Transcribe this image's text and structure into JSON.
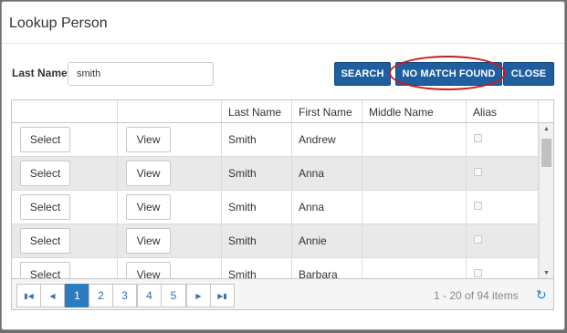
{
  "dialog": {
    "title": "Lookup Person"
  },
  "search": {
    "last_name_label": "Last Name",
    "last_name_value": "smith",
    "search_label": "SEARCH",
    "no_match_label": "NO MATCH FOUND",
    "close_label": "CLOSE"
  },
  "grid": {
    "columns": [
      "",
      "",
      "Last Name",
      "First Name",
      "Middle Name",
      "Alias"
    ],
    "select_label": "Select",
    "view_label": "View",
    "rows": [
      {
        "last": "Smith",
        "first": "Andrew",
        "middle": "",
        "alias": false
      },
      {
        "last": "Smith",
        "first": "Anna",
        "middle": "",
        "alias": false
      },
      {
        "last": "Smith",
        "first": "Anna",
        "middle": "",
        "alias": false
      },
      {
        "last": "Smith",
        "first": "Annie",
        "middle": "",
        "alias": false
      },
      {
        "last": "Smith",
        "first": "Barbara",
        "middle": "",
        "alias": false
      }
    ]
  },
  "pager": {
    "pages": [
      "1",
      "2",
      "3",
      "4",
      "5"
    ],
    "current_page": "1",
    "info": "1 - 20 of 94 items"
  },
  "colors": {
    "primary_button": "#1f5fa0",
    "active_page": "#2d7cc0",
    "annotation_circle": "#cc1a1a"
  },
  "icons": {
    "first_page": "first-page-icon",
    "prev_page": "prev-page-icon",
    "next_page": "next-page-icon",
    "last_page": "last-page-icon",
    "refresh": "refresh-icon"
  }
}
